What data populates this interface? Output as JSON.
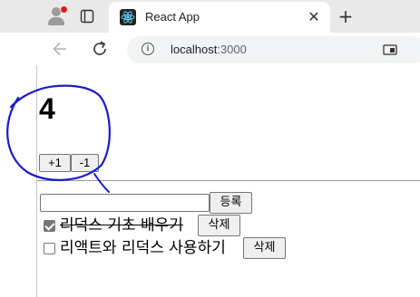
{
  "browser": {
    "tab_title": "React App",
    "close_glyph": "✕",
    "new_tab_glyph": "+",
    "url_host": "localhost",
    "url_port": ":3000",
    "icons": [
      "profile-avatar-icon",
      "tab-actions-icon",
      "react-favicon-icon",
      "back-arrow-icon",
      "reload-icon",
      "site-info-icon",
      "cast-icon"
    ],
    "notification_color": "#e21b1b"
  },
  "counter": {
    "value": "4",
    "increment_label": "+1",
    "decrement_label": "-1"
  },
  "todo_form": {
    "input_value": "",
    "submit_label": "등록"
  },
  "todos": [
    {
      "text": "리덕스 기초 배우기",
      "done": true,
      "delete_label": "삭제"
    },
    {
      "text": "리액트와 리덕스 사용하기",
      "done": false,
      "delete_label": "삭제"
    }
  ],
  "annotation": {
    "color": "#1a1acc",
    "shape": "hand-drawn circle around counter"
  }
}
